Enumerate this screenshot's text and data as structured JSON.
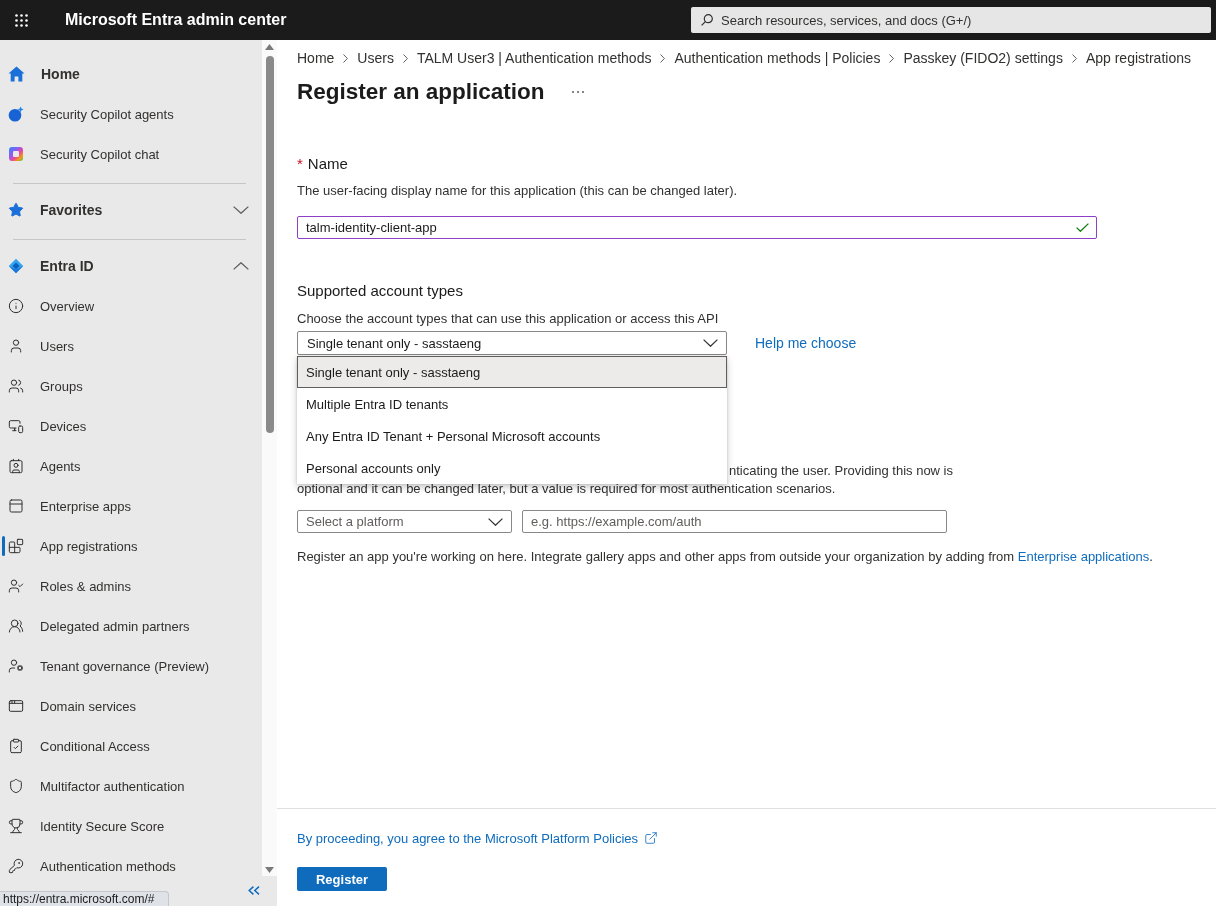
{
  "top_bar": {
    "title": "Microsoft Entra admin center",
    "search": {
      "placeholder": "Search resources, services, and docs (G+/)"
    }
  },
  "sidebar": {
    "items": [
      {
        "kind": "heading",
        "label": "Home",
        "selected": false
      },
      {
        "kind": "link",
        "label": "Security Copilot agents",
        "selected": false
      },
      {
        "kind": "link",
        "label": "Security Copilot chat",
        "selected": false
      },
      {
        "kind": "group",
        "label": "Favorites",
        "selected": false,
        "expanded": false
      },
      {
        "kind": "group",
        "label": "Entra ID",
        "selected": false,
        "expanded": true,
        "children": [
          {
            "label": "Overview",
            "selected": false
          },
          {
            "label": "Users",
            "selected": false
          },
          {
            "label": "Groups",
            "selected": false
          },
          {
            "label": "Devices",
            "selected": false
          },
          {
            "label": "Agents",
            "selected": false
          },
          {
            "label": "Enterprise apps",
            "selected": false
          },
          {
            "label": "App registrations",
            "selected": true
          },
          {
            "label": "Roles & admins",
            "selected": false
          },
          {
            "label": "Delegated admin partners",
            "selected": false
          },
          {
            "label": "Tenant governance (Preview)",
            "selected": false
          },
          {
            "label": "Domain services",
            "selected": false
          },
          {
            "label": "Conditional Access",
            "selected": false
          },
          {
            "label": "Multifactor authentication",
            "selected": false
          },
          {
            "label": "Identity Secure Score",
            "selected": false
          },
          {
            "label": "Authentication methods",
            "selected": false
          }
        ]
      }
    ]
  },
  "breadcrumb": [
    "Home",
    "Users",
    "TALM User3 | Authentication methods",
    "Authentication methods | Policies",
    "Passkey (FIDO2) settings",
    "App registrations"
  ],
  "page": {
    "title": "Register an application"
  },
  "name_field": {
    "required_mark": "*",
    "label": "Name",
    "description": "The user-facing display name for this application (this can be changed later).",
    "value": "talm-identity-client-app",
    "focused": true,
    "valid": true
  },
  "account_types": {
    "heading": "Supported account types",
    "description": "Choose the account types that can use this application or access this API",
    "value": "Single tenant only - sasstaeng",
    "expanded": true,
    "help_link": "Help me choose",
    "options": [
      {
        "label": "Single tenant only - sasstaeng",
        "selected": true
      },
      {
        "label": "Multiple Entra ID tenants",
        "selected": false
      },
      {
        "label": "Any Entra ID Tenant + Personal Microsoft accounts",
        "selected": false
      },
      {
        "label": "Personal accounts only",
        "selected": false
      }
    ]
  },
  "redirect_uri": {
    "description_lines": [
      "nticating the user. Providing this now is",
      "optional and it can be changed later, but a value is required for most authentication scenarios."
    ],
    "platform": {
      "placeholder": "Select a platform"
    },
    "uri": {
      "placeholder": "e.g. https://example.com/auth"
    }
  },
  "register_note": {
    "text": "Register an app you're working on here. Integrate gallery apps and other apps from outside your organization by adding from ",
    "link": "Enterprise applications",
    "suffix": "."
  },
  "footer": {
    "policy_link": "By proceeding, you agree to the Microsoft Platform Policies",
    "register_button": "Register"
  },
  "status_bar": {
    "url": "https://entra.microsoft.com/#"
  }
}
